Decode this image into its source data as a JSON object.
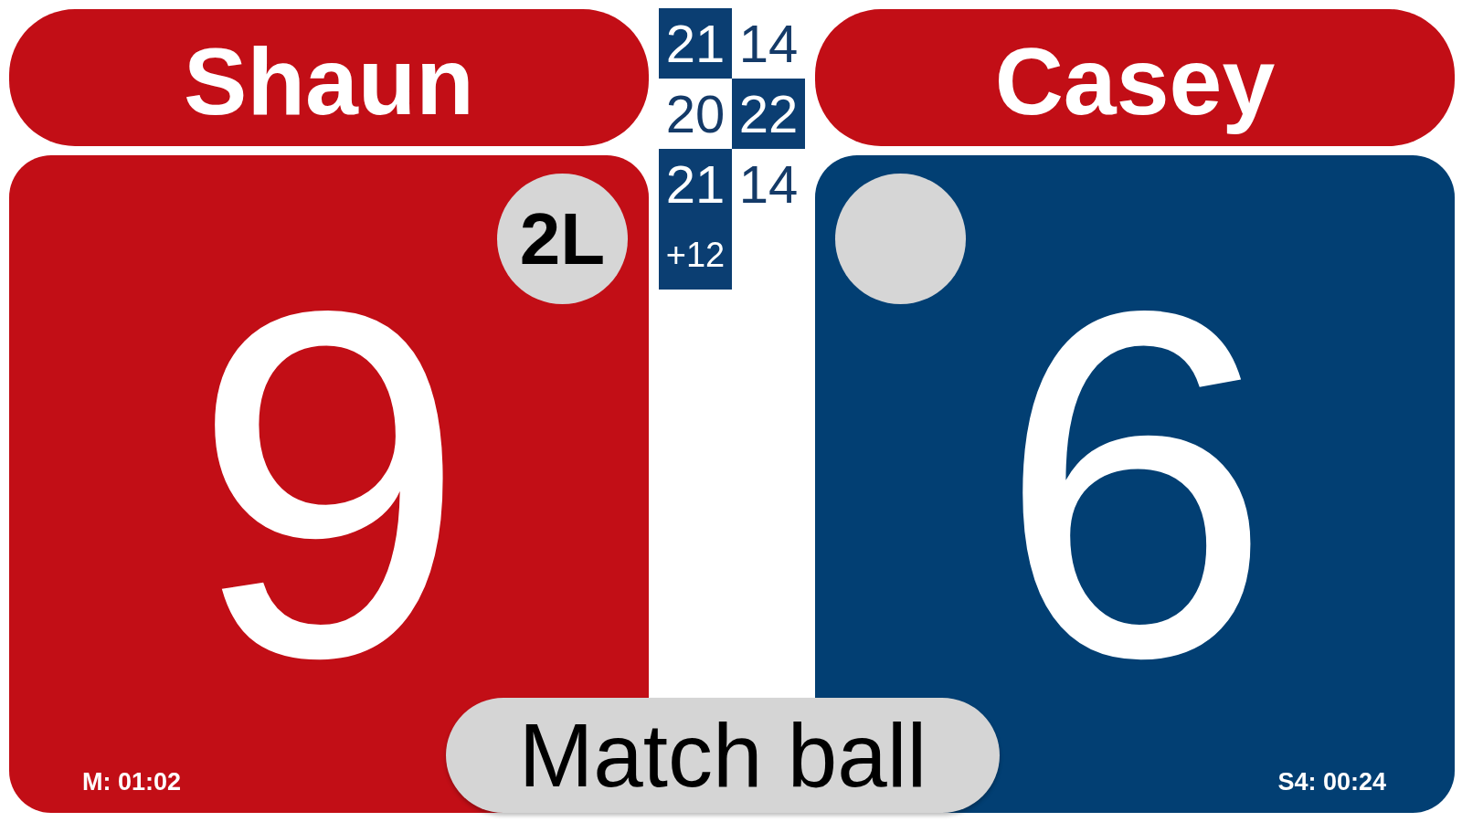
{
  "players": [
    {
      "name": "Shaun",
      "color": "#c20e16",
      "score": "9",
      "marker": {
        "kind": "label",
        "text": "2L"
      },
      "timer": "M: 01:02"
    },
    {
      "name": "Casey",
      "color": "#023f73",
      "score": "6",
      "marker": {
        "kind": "blank"
      },
      "timer": "S4: 00:24"
    }
  ],
  "sets": [
    {
      "scores": [
        {
          "value": "21",
          "won": true
        },
        {
          "value": "14",
          "won": false
        }
      ]
    },
    {
      "scores": [
        {
          "value": "20",
          "won": false
        },
        {
          "value": "22",
          "won": true
        }
      ]
    },
    {
      "scores": [
        {
          "value": "21",
          "won": true
        },
        {
          "value": "14",
          "won": false
        }
      ]
    }
  ],
  "point_difference": {
    "text": "+12"
  },
  "banner": {
    "text": "Match ball"
  }
}
